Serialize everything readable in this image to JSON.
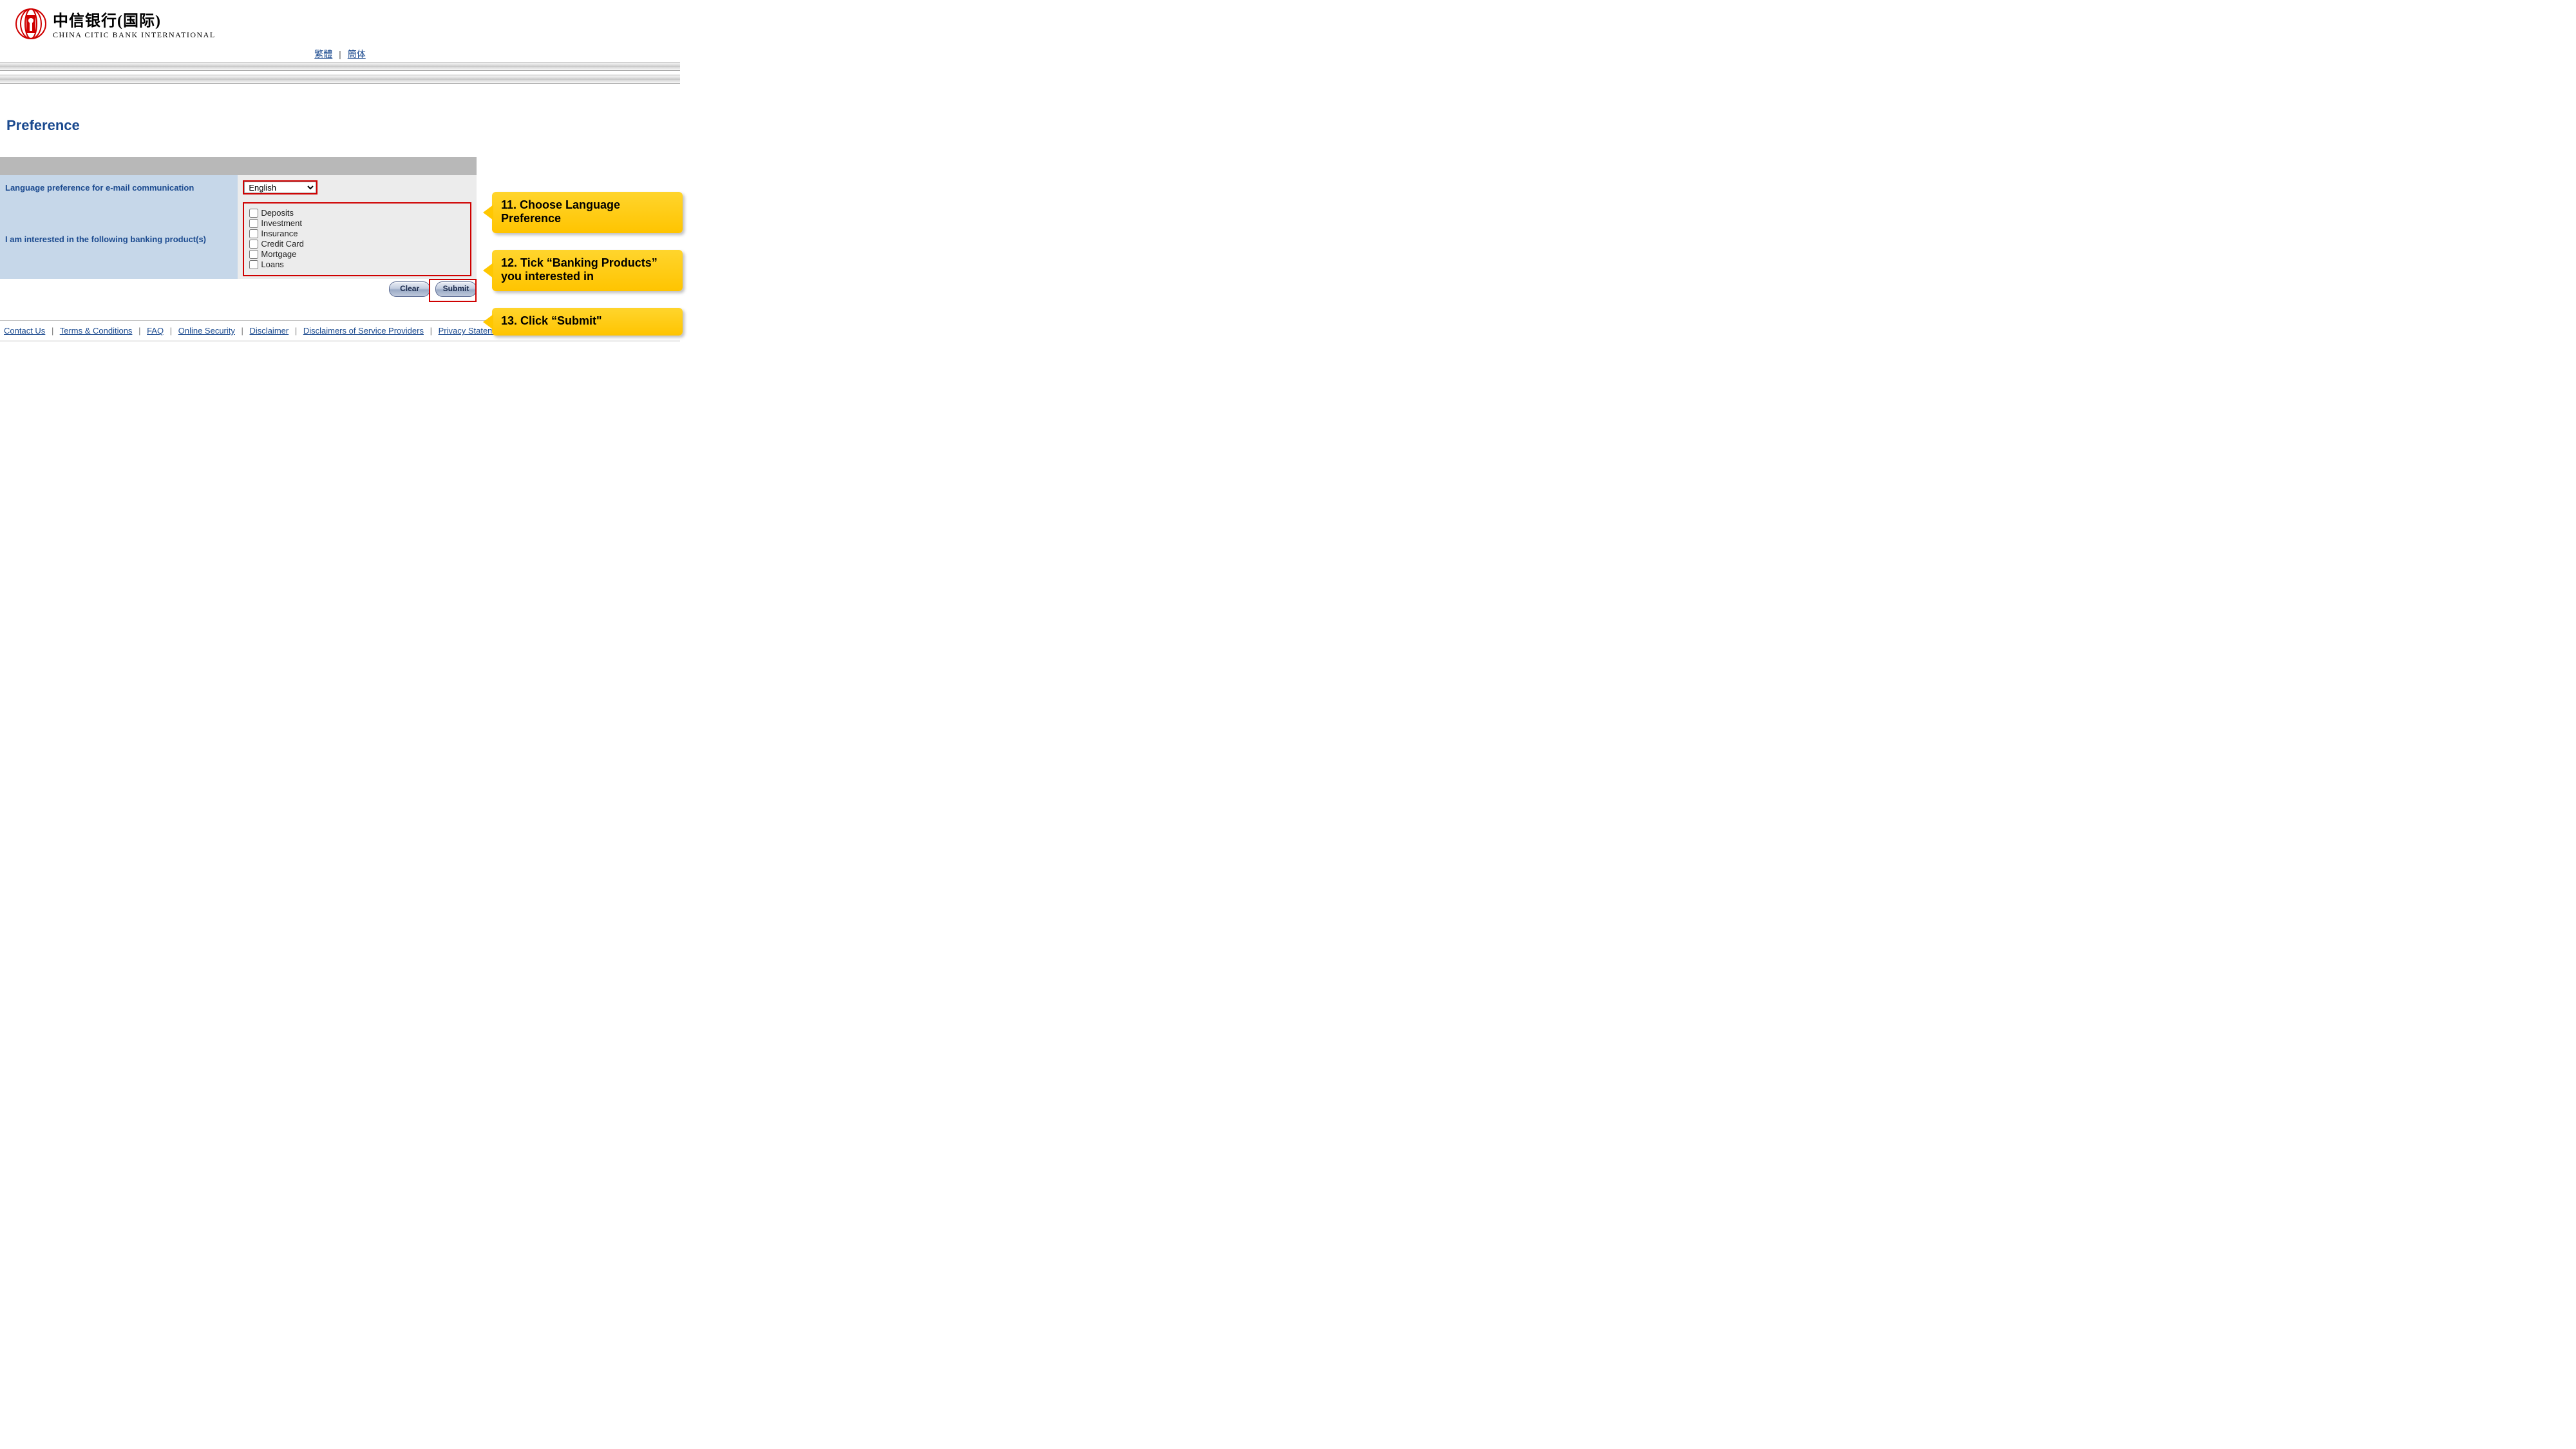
{
  "header": {
    "logo_cn": "中信银行(国际)",
    "logo_en": "CHINA CITIC BANK INTERNATIONAL",
    "lang_traditional": "繁體",
    "lang_simplified": "簡体",
    "lang_separator": "|"
  },
  "page": {
    "title": "Preference"
  },
  "form": {
    "row1_label": "Language preference for e-mail communication",
    "row1_value": "English",
    "row2_label": "I am interested in the following banking product(s)",
    "products": {
      "p0": "Deposits",
      "p1": "Investment",
      "p2": "Insurance",
      "p3": "Credit Card",
      "p4": "Mortgage",
      "p5": "Loans"
    },
    "clear_label": "Clear",
    "submit_label": "Submit"
  },
  "callouts": {
    "c1": "11. Choose Language Preference",
    "c2": "12. Tick “Banking Products” you interested in",
    "c3": "13. Click “Submit\""
  },
  "footer": {
    "l0": "Contact Us",
    "l1": "Terms & Conditions",
    "l2": "FAQ",
    "l3": "Online Security",
    "l4": "Disclaimer",
    "l5": "Disclaimers of Service Providers",
    "l6": "Privacy Statement",
    "sep": "|"
  },
  "colors": {
    "brand_red": "#cf0000",
    "brand_blue": "#1b4a8f",
    "callout_yellow": "#ffc400",
    "table_blue": "#c6d7e9",
    "table_gray": "#ececec"
  }
}
